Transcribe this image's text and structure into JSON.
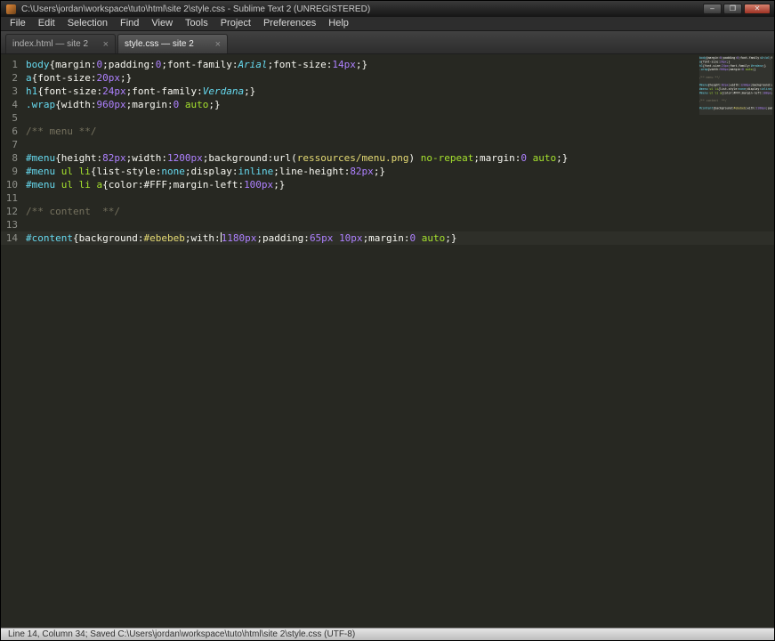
{
  "window": {
    "title": "C:\\Users\\jordan\\workspace\\tuto\\html\\site 2\\style.css - Sublime Text 2 (UNREGISTERED)",
    "controls": {
      "minimize": "–",
      "maximize": "❐",
      "close": "✕"
    }
  },
  "menu_bar": {
    "items": [
      "File",
      "Edit",
      "Selection",
      "Find",
      "View",
      "Tools",
      "Project",
      "Preferences",
      "Help"
    ]
  },
  "tab_bar": {
    "tabs": [
      {
        "label": "index.html — site 2",
        "active": false
      },
      {
        "label": "style.css — site 2",
        "active": true
      }
    ]
  },
  "editor": {
    "current_line": 14,
    "lines": [
      {
        "n": 1,
        "tokens": [
          [
            "sel",
            "body"
          ],
          [
            "pln",
            "{margin:"
          ],
          [
            "num",
            "0"
          ],
          [
            "pln",
            ";padding:"
          ],
          [
            "num",
            "0"
          ],
          [
            "pln",
            ";font-family:"
          ],
          [
            "fnt",
            "Arial"
          ],
          [
            "pln",
            ";font-size:"
          ],
          [
            "num",
            "14px"
          ],
          [
            "pln",
            ";}"
          ]
        ]
      },
      {
        "n": 2,
        "tokens": [
          [
            "sel",
            "a"
          ],
          [
            "pln",
            "{font-size:"
          ],
          [
            "num",
            "20px"
          ],
          [
            "pln",
            ";}"
          ]
        ]
      },
      {
        "n": 3,
        "tokens": [
          [
            "sel",
            "h1"
          ],
          [
            "pln",
            "{font-size:"
          ],
          [
            "num",
            "24px"
          ],
          [
            "pln",
            ";font-family:"
          ],
          [
            "fnt",
            "Verdana"
          ],
          [
            "pln",
            ";}"
          ]
        ]
      },
      {
        "n": 4,
        "tokens": [
          [
            "sel",
            ".wrap"
          ],
          [
            "pln",
            "{width:"
          ],
          [
            "num",
            "960px"
          ],
          [
            "pln",
            ";margin:"
          ],
          [
            "num",
            "0"
          ],
          [
            "pln",
            " "
          ],
          [
            "kwg",
            "auto"
          ],
          [
            "pln",
            ";}"
          ]
        ]
      },
      {
        "n": 5,
        "tokens": []
      },
      {
        "n": 6,
        "tokens": [
          [
            "cmt",
            "/** menu **/"
          ]
        ]
      },
      {
        "n": 7,
        "tokens": []
      },
      {
        "n": 8,
        "tokens": [
          [
            "sel",
            "#menu"
          ],
          [
            "pln",
            "{height:"
          ],
          [
            "num",
            "82px"
          ],
          [
            "pln",
            ";width:"
          ],
          [
            "num",
            "1200px"
          ],
          [
            "pln",
            ";background:"
          ],
          [
            "pln",
            "url("
          ],
          [
            "str",
            "ressources/menu.png"
          ],
          [
            "pln",
            ") "
          ],
          [
            "kwg",
            "no-repeat"
          ],
          [
            "pln",
            ";margin:"
          ],
          [
            "num",
            "0"
          ],
          [
            "pln",
            " "
          ],
          [
            "kwg",
            "auto"
          ],
          [
            "pln",
            ";}"
          ]
        ]
      },
      {
        "n": 9,
        "tokens": [
          [
            "sel",
            "#menu"
          ],
          [
            "pln",
            " "
          ],
          [
            "tag",
            "ul li"
          ],
          [
            "pln",
            "{list-style:"
          ],
          [
            "kwc",
            "none"
          ],
          [
            "pln",
            ";display:"
          ],
          [
            "kwc",
            "inline"
          ],
          [
            "pln",
            ";line-height:"
          ],
          [
            "num",
            "82px"
          ],
          [
            "pln",
            ";}"
          ]
        ]
      },
      {
        "n": 10,
        "tokens": [
          [
            "sel",
            "#menu"
          ],
          [
            "pln",
            " "
          ],
          [
            "tag",
            "ul li a"
          ],
          [
            "pln",
            "{color:"
          ],
          [
            "hexw",
            "#FFF"
          ],
          [
            "pln",
            ";margin-left:"
          ],
          [
            "num",
            "100px"
          ],
          [
            "pln",
            ";}"
          ]
        ]
      },
      {
        "n": 11,
        "tokens": []
      },
      {
        "n": 12,
        "tokens": [
          [
            "cmt",
            "/** content  **/"
          ]
        ]
      },
      {
        "n": 13,
        "tokens": []
      },
      {
        "n": 14,
        "tokens": [
          [
            "sel",
            "#content"
          ],
          [
            "pln",
            "{background:"
          ],
          [
            "hexy",
            "#ebebeb"
          ],
          [
            "pln",
            ";with:"
          ],
          [
            "cur",
            ""
          ],
          [
            "num",
            "1180px"
          ],
          [
            "pln",
            ";padding:"
          ],
          [
            "num",
            "65px"
          ],
          [
            "pln",
            " "
          ],
          [
            "num",
            "10px"
          ],
          [
            "pln",
            ";margin:"
          ],
          [
            "num",
            "0"
          ],
          [
            "pln",
            " "
          ],
          [
            "kwg",
            "auto"
          ],
          [
            "pln",
            ";}"
          ]
        ]
      }
    ]
  },
  "status_bar": {
    "text": "Line 14, Column 34; Saved C:\\Users\\jordan\\workspace\\tuto\\html\\site 2\\style.css (UTF-8)"
  },
  "palette": {
    "editor_background": "#272822",
    "line_numbers": "#8f908a",
    "plain_text": "#f8f8f2",
    "selector": "#66d9ef",
    "sub_selector": "#a6e22e",
    "number": "#ae81ff",
    "string": "#e6db74",
    "keyword_green": "#a6e22e",
    "keyword_cyan": "#66d9ef",
    "comment": "#75715e",
    "close_button": "#9d3123"
  }
}
